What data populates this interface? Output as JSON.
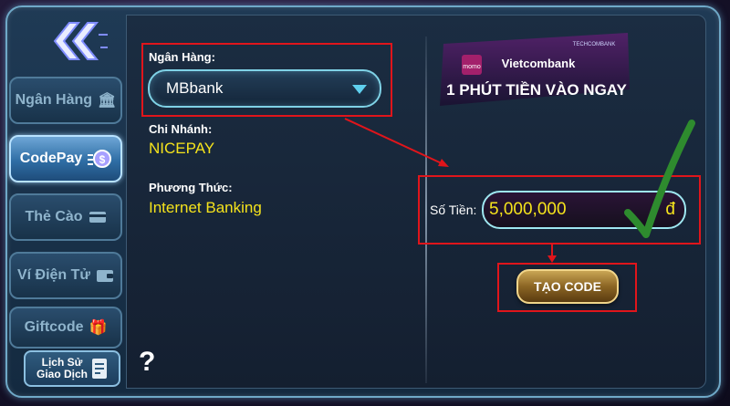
{
  "sidebar": {
    "items": [
      {
        "label": "Ngân Hàng",
        "icon": "bank-icon",
        "active": false
      },
      {
        "label": "CodePay",
        "icon": "coin-icon",
        "active": true
      },
      {
        "label": "Thẻ Cào",
        "icon": "card-icon",
        "active": false
      },
      {
        "label": "Ví Điện Tử",
        "icon": "wallet-icon",
        "active": false
      },
      {
        "label": "Giftcode",
        "icon": "gift-icon",
        "active": false
      }
    ],
    "history": {
      "line1": "Lịch Sử",
      "line2": "Giao Dịch"
    },
    "help": "?"
  },
  "form": {
    "bank_label": "Ngân Hàng:",
    "bank_selected": "MBbank",
    "branch_label": "Chi Nhánh:",
    "branch_value": "NICEPAY",
    "method_label": "Phương Thức:",
    "method_value": "Internet Banking",
    "amount_label": "Số Tiền:",
    "amount_value": "5,000,000",
    "currency": "đ",
    "create_button": "TẠO CODE"
  },
  "banner": {
    "brand1": "momo",
    "brand2": "Vietcombank",
    "brand3": "TECHCOMBANK",
    "tagline": "1 PHÚT TIỀN VÀO NGAY"
  },
  "colors": {
    "accent_yellow": "#f5e31c",
    "annotation_red": "#e0151b",
    "check_green": "#2e8b2e"
  }
}
